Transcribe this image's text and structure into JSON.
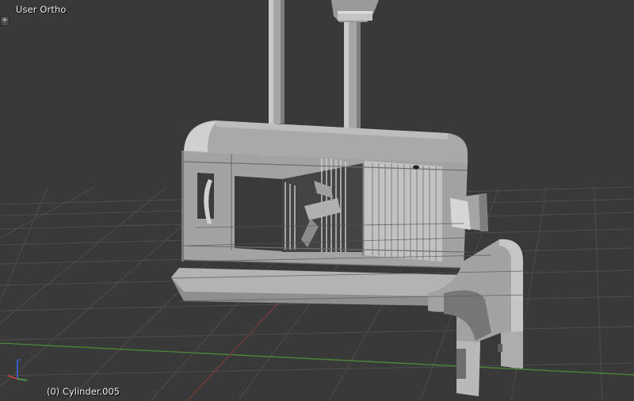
{
  "viewport": {
    "view_name": "User Ortho",
    "toggle_symbol": "+",
    "active_object": "(0) Cylinder.005"
  },
  "colors": {
    "background": "#393939",
    "grid_line": "#4c4c4c",
    "x_axis": "#8b3a3a",
    "y_axis": "#4b8b33",
    "mesh_light": "#b7b7b7",
    "mesh_mid": "#9e9e9e",
    "mesh_dark": "#6e6e6e",
    "selection_outline": "#e38a2a"
  },
  "icons": {
    "axis_widget": "xyz-axis-gizmo-icon"
  }
}
